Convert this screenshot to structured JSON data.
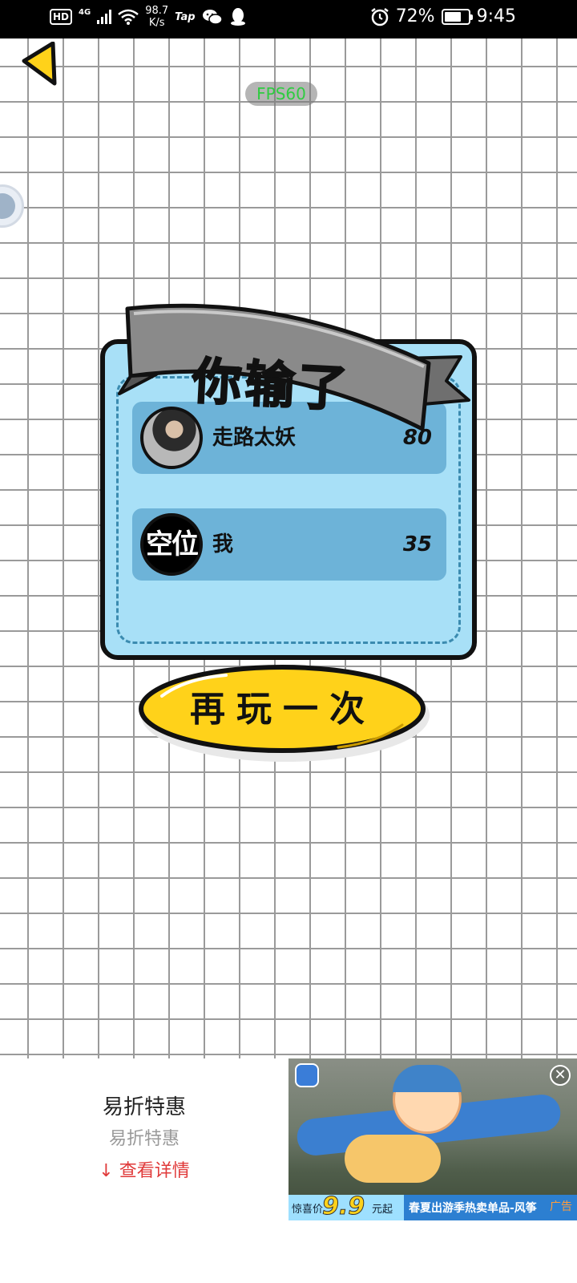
{
  "status_bar": {
    "hd": "HD",
    "network": "4G",
    "speed_value": "98.7",
    "speed_unit": "K/s",
    "tap_label": "Tap",
    "battery_percent": "72%",
    "battery_level": 0.72,
    "time": "9:45"
  },
  "game": {
    "fps_label": "FPS60",
    "result_title": "你输了",
    "players": [
      {
        "name": "走路太妖",
        "score": "80"
      },
      {
        "name": "我",
        "avatar_text": "空位",
        "score": "35"
      }
    ],
    "replay_label": "再玩一次"
  },
  "ad": {
    "title": "易折特惠",
    "subtitle": "易折特惠",
    "cta_arrow": "↓",
    "cta_label": "查看详情",
    "price_label": "惊喜价",
    "price_value": "9.9",
    "price_unit": "元起",
    "strip_text": "春夏出游季热卖单品-风筝",
    "corner_tag": "广告",
    "close_glyph": "✕"
  }
}
